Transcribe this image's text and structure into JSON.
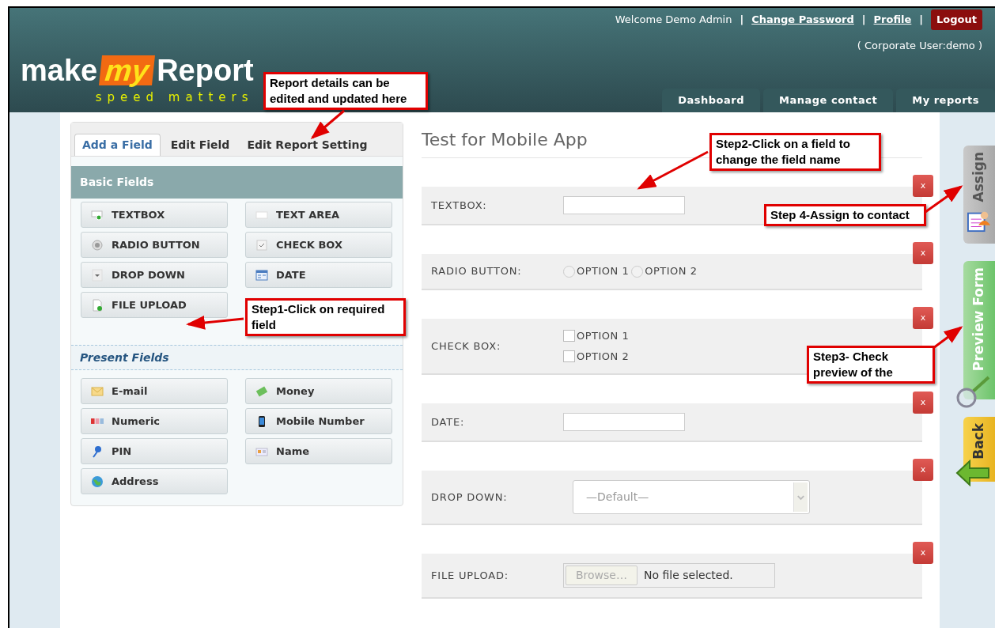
{
  "header": {
    "welcome": "Welcome Demo Admin",
    "separator": "|",
    "links": [
      "Change Password",
      "Profile"
    ],
    "logout": "Logout",
    "corporate_user": "( Corporate User:demo )",
    "logo": {
      "make": "make",
      "my": "my",
      "report": "Report",
      "tagline": "speed matters"
    },
    "nav": [
      {
        "label": "Dashboard"
      },
      {
        "label": "Manage contact"
      },
      {
        "label": "My reports"
      }
    ]
  },
  "builder": {
    "tabs": [
      {
        "label": "Add a Field",
        "selected": true
      },
      {
        "label": "Edit Field",
        "selected": false
      },
      {
        "label": "Edit Report Setting",
        "selected": false
      }
    ],
    "basic_title": "Basic Fields",
    "basic_fields": [
      {
        "label": "TEXTBOX",
        "kind": "textbox"
      },
      {
        "label": "TEXT AREA",
        "kind": "textarea"
      },
      {
        "label": "RADIO BUTTON",
        "kind": "radio"
      },
      {
        "label": "CHECK BOX",
        "kind": "checkbox"
      },
      {
        "label": "DROP DOWN",
        "kind": "dropdown"
      },
      {
        "label": "DATE",
        "kind": "date"
      },
      {
        "label": "FILE UPLOAD",
        "kind": "file"
      }
    ],
    "present_title": "Present Fields",
    "present_fields": [
      {
        "label": "E-mail",
        "kind": "email"
      },
      {
        "label": "Money",
        "kind": "money"
      },
      {
        "label": "Numeric",
        "kind": "numeric"
      },
      {
        "label": "Mobile Number",
        "kind": "mobile"
      },
      {
        "label": "PIN",
        "kind": "pin"
      },
      {
        "label": "Name",
        "kind": "name"
      },
      {
        "label": "Address",
        "kind": "address"
      }
    ]
  },
  "form": {
    "title": "Test for Mobile App",
    "fields": [
      {
        "kind": "text",
        "label": "TEXTBOX:",
        "delete": "x"
      },
      {
        "kind": "radio",
        "label": "RADIO BUTTON:",
        "delete": "x",
        "options": [
          {
            "label": "OPTION 1",
            "selected": false
          },
          {
            "label": "OPTION 2",
            "selected": false
          }
        ]
      },
      {
        "kind": "checkbox",
        "label": "CHECK BOX:",
        "delete": "x",
        "options": [
          {
            "label": "OPTION 1",
            "checked": false
          },
          {
            "label": "OPTION 2",
            "checked": false
          }
        ]
      },
      {
        "kind": "text",
        "label": "DATE:",
        "delete": "x"
      },
      {
        "kind": "select",
        "label": "DROP DOWN:",
        "delete": "x",
        "value": "—Default—"
      },
      {
        "kind": "file",
        "label": "FILE UPLOAD:",
        "delete": "x",
        "button": "Browse…",
        "status": "No file selected."
      }
    ]
  },
  "side_tabs": [
    {
      "label": "Assign",
      "kind": "assign"
    },
    {
      "label": "Preview Form",
      "kind": "preview"
    },
    {
      "label": "Back",
      "kind": "back"
    }
  ],
  "callouts": [
    {
      "text": "Report details can be edited and updated here"
    },
    {
      "text": "Step2-Click on a field to change the field name"
    },
    {
      "text": "Step 4-Assign to contact"
    },
    {
      "text": "Step1-Click on required field"
    },
    {
      "text": "Step3- Check preview of the"
    }
  ]
}
